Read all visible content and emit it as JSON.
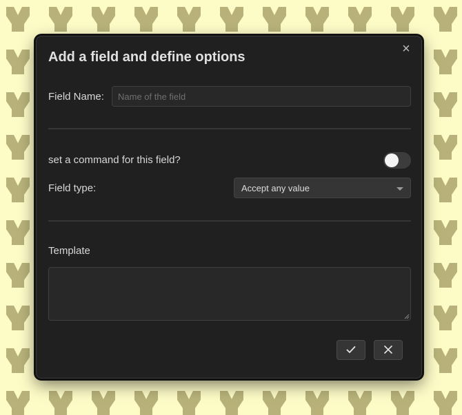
{
  "dialog": {
    "title": "Add a field and define options",
    "close_icon": "close-icon",
    "field_name": {
      "label": "Field Name:",
      "value": "",
      "placeholder": "Name of the field"
    },
    "command_toggle": {
      "label": "set a command for this field?",
      "checked": false
    },
    "field_type": {
      "label": "Field type:",
      "selected": "Accept any value"
    },
    "template": {
      "label": "Template",
      "value": ""
    },
    "buttons": {
      "confirm_icon": "checkmark-icon",
      "cancel_icon": "close-icon"
    }
  },
  "colors": {
    "background": "#fdfbc6",
    "pattern": "#b8b27a",
    "modal": "#202020"
  }
}
